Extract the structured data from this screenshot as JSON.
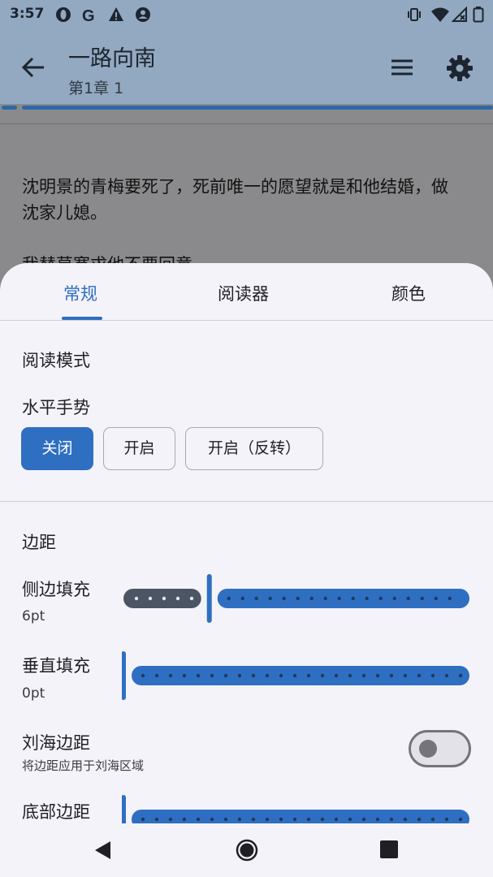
{
  "status_bar": {
    "time": "3:57",
    "icons_left": [
      "opera-icon",
      "google-icon",
      "warning-icon",
      "account-icon"
    ],
    "icons_right": [
      "vibrate-icon",
      "wifi-icon",
      "signal-no-data-icon",
      "battery-icon"
    ]
  },
  "app_bar": {
    "title": "一路向南",
    "subtitle": "第1章 1"
  },
  "reader": {
    "paragraph1": "沈明景的青梅要死了，死前唯一的愿望就是和他结婚，做沈家儿媳。",
    "paragraph2": "我替莫寒求他不要回意"
  },
  "sheet": {
    "tabs": [
      {
        "label": "常规",
        "selected": true
      },
      {
        "label": "阅读器",
        "selected": false
      },
      {
        "label": "颜色",
        "selected": false
      }
    ],
    "reading_mode": {
      "title": "阅读模式",
      "gesture_label": "水平手势",
      "options": [
        {
          "label": "关闭",
          "selected": true
        },
        {
          "label": "开启",
          "selected": false
        },
        {
          "label": "开启（反转）",
          "selected": false
        }
      ]
    },
    "margins": {
      "title": "边距",
      "side_padding": {
        "label": "侧边填充",
        "value": "6pt",
        "fraction": 0.22
      },
      "vertical_padding": {
        "label": "垂直填充",
        "value": "0pt",
        "fraction": 0.0
      },
      "notch_margin": {
        "label": "刘海边距",
        "description": "将边距应用于刘海区域",
        "enabled": false
      },
      "bottom_margin": {
        "label": "底部边距",
        "fraction": 0.0
      }
    }
  },
  "colors": {
    "accent": "#2f6fc2",
    "inactive_track": "#4b5563"
  }
}
